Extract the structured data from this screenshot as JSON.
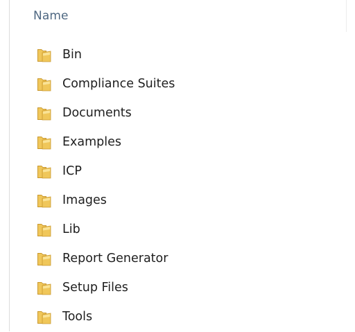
{
  "colors": {
    "header_text": "#4f6882",
    "item_text": "#1e1e1e",
    "folder_body": "#f0c75a",
    "folder_dark": "#c9982e",
    "folder_light": "#fbe7a1"
  },
  "column_header": {
    "name_label": "Name"
  },
  "files": [
    {
      "name": "Bin",
      "icon": "folder-icon"
    },
    {
      "name": "Compliance Suites",
      "icon": "folder-icon"
    },
    {
      "name": "Documents",
      "icon": "folder-icon"
    },
    {
      "name": "Examples",
      "icon": "folder-icon"
    },
    {
      "name": "ICP",
      "icon": "folder-icon"
    },
    {
      "name": "Images",
      "icon": "folder-icon"
    },
    {
      "name": "Lib",
      "icon": "folder-icon"
    },
    {
      "name": "Report Generator",
      "icon": "folder-icon"
    },
    {
      "name": "Setup Files",
      "icon": "folder-icon"
    },
    {
      "name": "Tools",
      "icon": "folder-icon"
    }
  ]
}
